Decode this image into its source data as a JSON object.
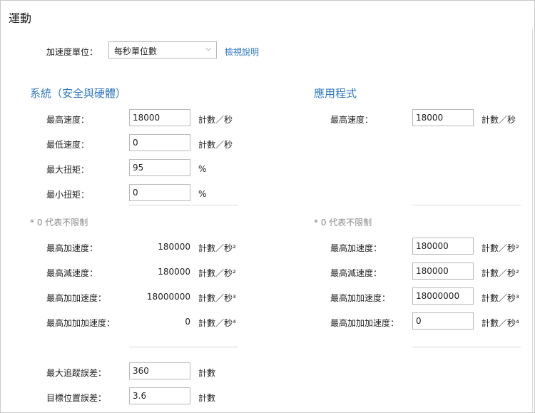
{
  "page": {
    "title": "運動"
  },
  "accel_unit": {
    "label": "加速度單位：",
    "selected": "每秒單位數",
    "help_link": "檢視說明"
  },
  "system": {
    "title": "系統（安全與硬體）",
    "max_speed": {
      "label": "最高速度：",
      "value": "18000",
      "unit": "計數／秒"
    },
    "min_speed": {
      "label": "最低速度：",
      "value": "0",
      "unit": "計數／秒"
    },
    "max_torque": {
      "label": "最大扭矩：",
      "value": "95",
      "unit": "%"
    },
    "min_torque": {
      "label": "最小扭矩：",
      "value": "0",
      "unit": "%"
    },
    "note": "* 0 代表不限制",
    "max_accel": {
      "label": "最高加速度：",
      "value": "180000",
      "unit": "計數／秒²"
    },
    "max_decel": {
      "label": "最高減速度：",
      "value": "180000",
      "unit": "計數／秒²"
    },
    "max_jerk": {
      "label": "最高加加速度：",
      "value": "18000000",
      "unit": "計數／秒³"
    },
    "max_snap": {
      "label": "最高加加加速度：",
      "value": "0",
      "unit": "計數／秒⁴"
    },
    "max_following_error": {
      "label": "最大追蹤誤差：",
      "value": "360",
      "unit": "計數"
    },
    "target_position_error": {
      "label": "目標位置誤差：",
      "value": "3.6",
      "unit": "計數"
    }
  },
  "application": {
    "title": "應用程式",
    "max_speed": {
      "label": "最高速度：",
      "value": "18000",
      "unit": "計數／秒"
    },
    "note": "* 0 代表不限制",
    "max_accel": {
      "label": "最高加速度：",
      "value": "180000",
      "unit": "計數／秒²"
    },
    "max_decel": {
      "label": "最高減速度：",
      "value": "180000",
      "unit": "計數／秒²"
    },
    "max_jerk": {
      "label": "最高加加速度：",
      "value": "18000000",
      "unit": "計數／秒³"
    },
    "max_snap": {
      "label": "最高加加加速度：",
      "value": "0",
      "unit": "計數／秒⁴"
    }
  }
}
